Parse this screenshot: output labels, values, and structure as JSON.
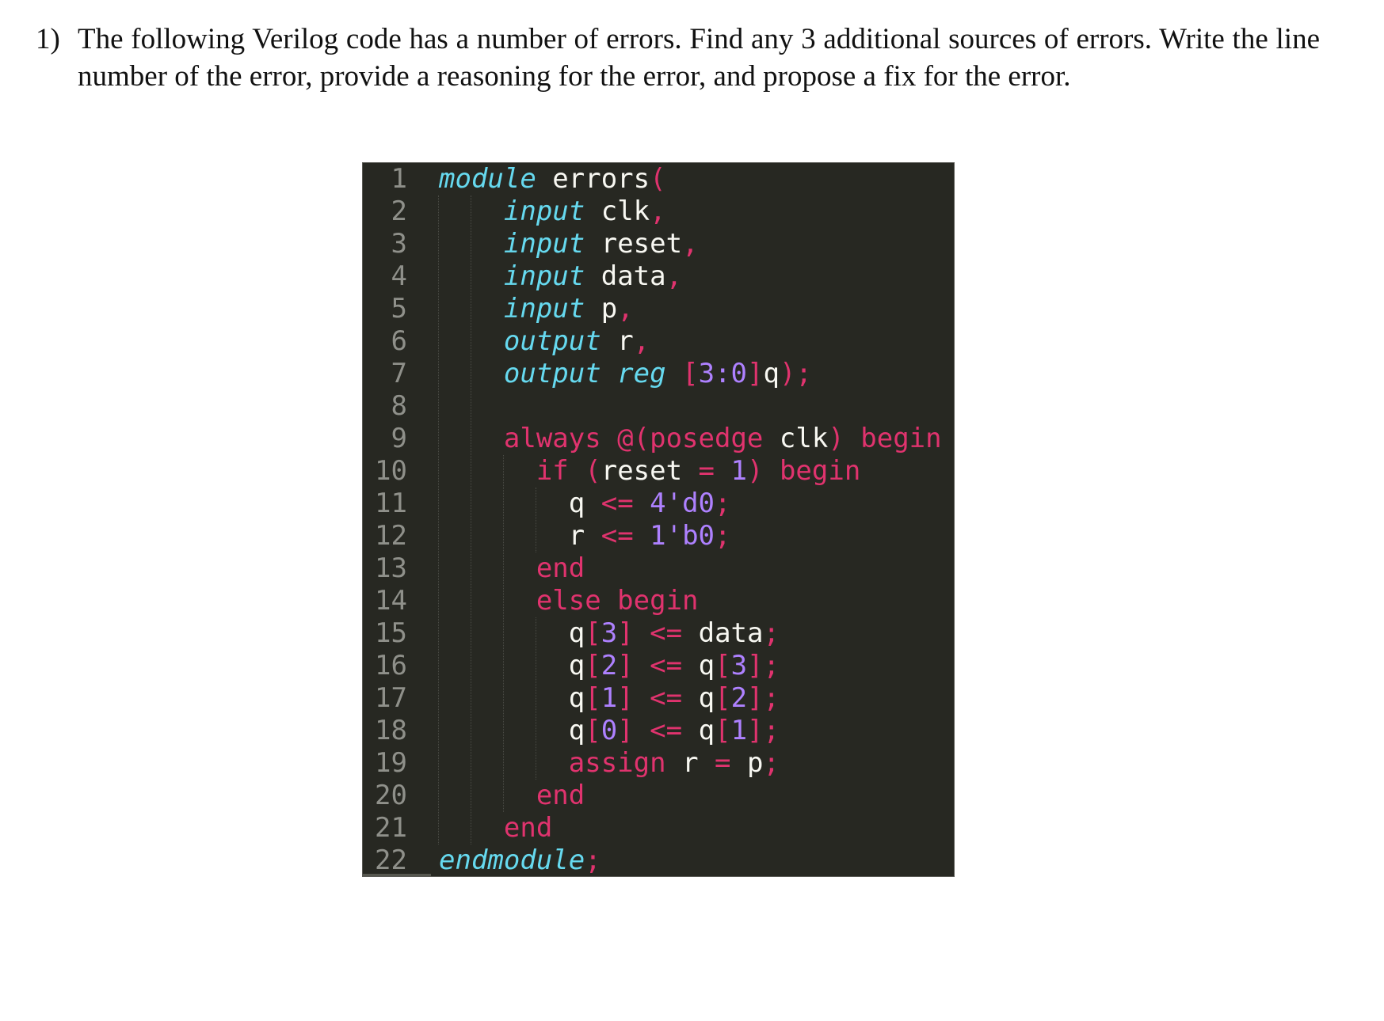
{
  "question": {
    "number": "1)",
    "text": "The following Verilog code has a number of errors.  Find any 3 additional sources of errors. Write the line number of the error, provide a reasoning for the error, and propose a fix for the error."
  },
  "code": {
    "language": "Verilog",
    "theme_colors": {
      "background": "#272822",
      "keyword": "#e0336e",
      "type": "#66d9ef",
      "number": "#ae81ff",
      "identifier": "#f8f8f2",
      "line_number": "#8f908a"
    },
    "lines": [
      {
        "n": "1",
        "indent": 0,
        "tokens": [
          [
            "kw-type",
            "module"
          ],
          [
            "id",
            " errors"
          ],
          [
            "op",
            "("
          ]
        ]
      },
      {
        "n": "2",
        "indent": 4,
        "tokens": [
          [
            "kw-type",
            "input"
          ],
          [
            "id",
            " clk"
          ],
          [
            "op",
            ","
          ]
        ]
      },
      {
        "n": "3",
        "indent": 4,
        "tokens": [
          [
            "kw-type",
            "input"
          ],
          [
            "id",
            " reset"
          ],
          [
            "op",
            ","
          ]
        ]
      },
      {
        "n": "4",
        "indent": 4,
        "tokens": [
          [
            "kw-type",
            "input"
          ],
          [
            "id",
            " data"
          ],
          [
            "op",
            ","
          ]
        ]
      },
      {
        "n": "5",
        "indent": 4,
        "tokens": [
          [
            "kw-type",
            "input"
          ],
          [
            "id",
            " p"
          ],
          [
            "op",
            ","
          ]
        ]
      },
      {
        "n": "6",
        "indent": 4,
        "tokens": [
          [
            "kw-type",
            "output"
          ],
          [
            "id",
            " r"
          ],
          [
            "op",
            ","
          ]
        ]
      },
      {
        "n": "7",
        "indent": 4,
        "tokens": [
          [
            "kw-type",
            "output reg"
          ],
          [
            "id",
            " "
          ],
          [
            "op",
            "["
          ],
          [
            "num",
            "3:0"
          ],
          [
            "op",
            "]"
          ],
          [
            "id",
            "q"
          ],
          [
            "op",
            ");"
          ]
        ]
      },
      {
        "n": "8",
        "indent": 4,
        "tokens": []
      },
      {
        "n": "9",
        "indent": 4,
        "tokens": [
          [
            "kw",
            "always @(posedge"
          ],
          [
            "id",
            " clk"
          ],
          [
            "op",
            ")"
          ],
          [
            "kw",
            " begin"
          ]
        ]
      },
      {
        "n": "10",
        "indent": 6,
        "tokens": [
          [
            "kw",
            "if ("
          ],
          [
            "id",
            "reset"
          ],
          [
            "op",
            " = "
          ],
          [
            "num",
            "1"
          ],
          [
            "op",
            ")"
          ],
          [
            "kw",
            " begin"
          ]
        ]
      },
      {
        "n": "11",
        "indent": 8,
        "tokens": [
          [
            "id",
            "q"
          ],
          [
            "op",
            " <= "
          ],
          [
            "num",
            "4'd0"
          ],
          [
            "op",
            ";"
          ]
        ]
      },
      {
        "n": "12",
        "indent": 8,
        "tokens": [
          [
            "id",
            "r"
          ],
          [
            "op",
            " <= "
          ],
          [
            "num",
            "1'b0"
          ],
          [
            "op",
            ";"
          ]
        ]
      },
      {
        "n": "13",
        "indent": 6,
        "tokens": [
          [
            "kw",
            "end"
          ]
        ]
      },
      {
        "n": "14",
        "indent": 6,
        "tokens": [
          [
            "kw",
            "else begin"
          ]
        ]
      },
      {
        "n": "15",
        "indent": 8,
        "tokens": [
          [
            "id",
            "q"
          ],
          [
            "op",
            "["
          ],
          [
            "num",
            "3"
          ],
          [
            "op",
            "]"
          ],
          [
            "op",
            " <= "
          ],
          [
            "id",
            "data"
          ],
          [
            "op",
            ";"
          ]
        ]
      },
      {
        "n": "16",
        "indent": 8,
        "tokens": [
          [
            "id",
            "q"
          ],
          [
            "op",
            "["
          ],
          [
            "num",
            "2"
          ],
          [
            "op",
            "]"
          ],
          [
            "op",
            " <= "
          ],
          [
            "id",
            "q"
          ],
          [
            "op",
            "["
          ],
          [
            "num",
            "3"
          ],
          [
            "op",
            "];"
          ]
        ]
      },
      {
        "n": "17",
        "indent": 8,
        "tokens": [
          [
            "id",
            "q"
          ],
          [
            "op",
            "["
          ],
          [
            "num",
            "1"
          ],
          [
            "op",
            "]"
          ],
          [
            "op",
            " <= "
          ],
          [
            "id",
            "q"
          ],
          [
            "op",
            "["
          ],
          [
            "num",
            "2"
          ],
          [
            "op",
            "];"
          ]
        ]
      },
      {
        "n": "18",
        "indent": 8,
        "tokens": [
          [
            "id",
            "q"
          ],
          [
            "op",
            "["
          ],
          [
            "num",
            "0"
          ],
          [
            "op",
            "]"
          ],
          [
            "op",
            " <= "
          ],
          [
            "id",
            "q"
          ],
          [
            "op",
            "["
          ],
          [
            "num",
            "1"
          ],
          [
            "op",
            "];"
          ]
        ]
      },
      {
        "n": "19",
        "indent": 8,
        "tokens": [
          [
            "kw",
            "assign"
          ],
          [
            "id",
            " r"
          ],
          [
            "op",
            " = "
          ],
          [
            "id",
            "p"
          ],
          [
            "op",
            ";"
          ]
        ]
      },
      {
        "n": "20",
        "indent": 6,
        "tokens": [
          [
            "kw",
            "end"
          ]
        ]
      },
      {
        "n": "21",
        "indent": 4,
        "tokens": [
          [
            "kw",
            "end"
          ]
        ]
      },
      {
        "n": "22",
        "indent": 0,
        "tokens": [
          [
            "kw-type",
            "endmodule"
          ],
          [
            "op",
            ";"
          ]
        ]
      }
    ]
  }
}
